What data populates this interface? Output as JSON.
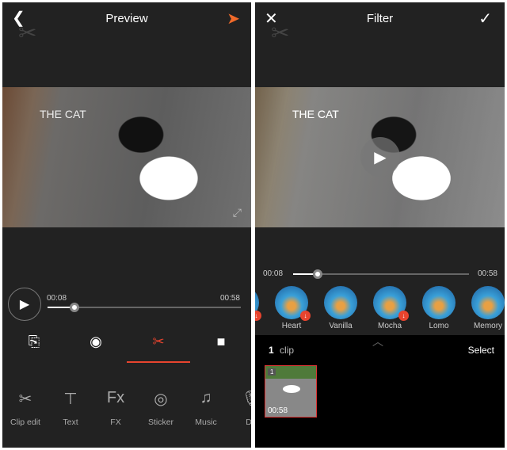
{
  "preview": {
    "title": "Preview",
    "back_icon": "chevron-left-icon",
    "send_icon": "paper-plane-icon",
    "accent": "#e8442e",
    "video_text": "THE CAT",
    "current_time": "00:08",
    "total_time": "00:58",
    "progress": 0.14,
    "tabs": [
      {
        "icon": "clip-import-icon"
      },
      {
        "icon": "music-disc-icon"
      },
      {
        "icon": "clip-edit-scissor-icon",
        "active": true
      },
      {
        "icon": "save-icon"
      }
    ],
    "tools": [
      {
        "label": "Clip edit",
        "glyph": "✂"
      },
      {
        "label": "Text",
        "glyph": "⊤"
      },
      {
        "label": "FX",
        "glyph": "Fx"
      },
      {
        "label": "Sticker",
        "glyph": "◎"
      },
      {
        "label": "Music",
        "glyph": "♫"
      },
      {
        "label": "Du",
        "glyph": "🎙"
      }
    ]
  },
  "filter": {
    "title": "Filter",
    "close_icon": "close-icon",
    "confirm_icon": "check-icon",
    "video_text": "THE CAT",
    "current_time": "00:08",
    "total_time": "00:58",
    "progress": 0.14,
    "filters": [
      {
        "label": "es",
        "download": true
      },
      {
        "label": "Heart",
        "download": true
      },
      {
        "label": "Vanilla",
        "download": false
      },
      {
        "label": "Mocha",
        "download": true
      },
      {
        "label": "Lomo",
        "download": false
      },
      {
        "label": "Memory",
        "download": false
      }
    ],
    "clip_count": "1",
    "clip_word": "clip",
    "select_label": "Select",
    "clip": {
      "index": "1",
      "duration": "00:58"
    }
  }
}
